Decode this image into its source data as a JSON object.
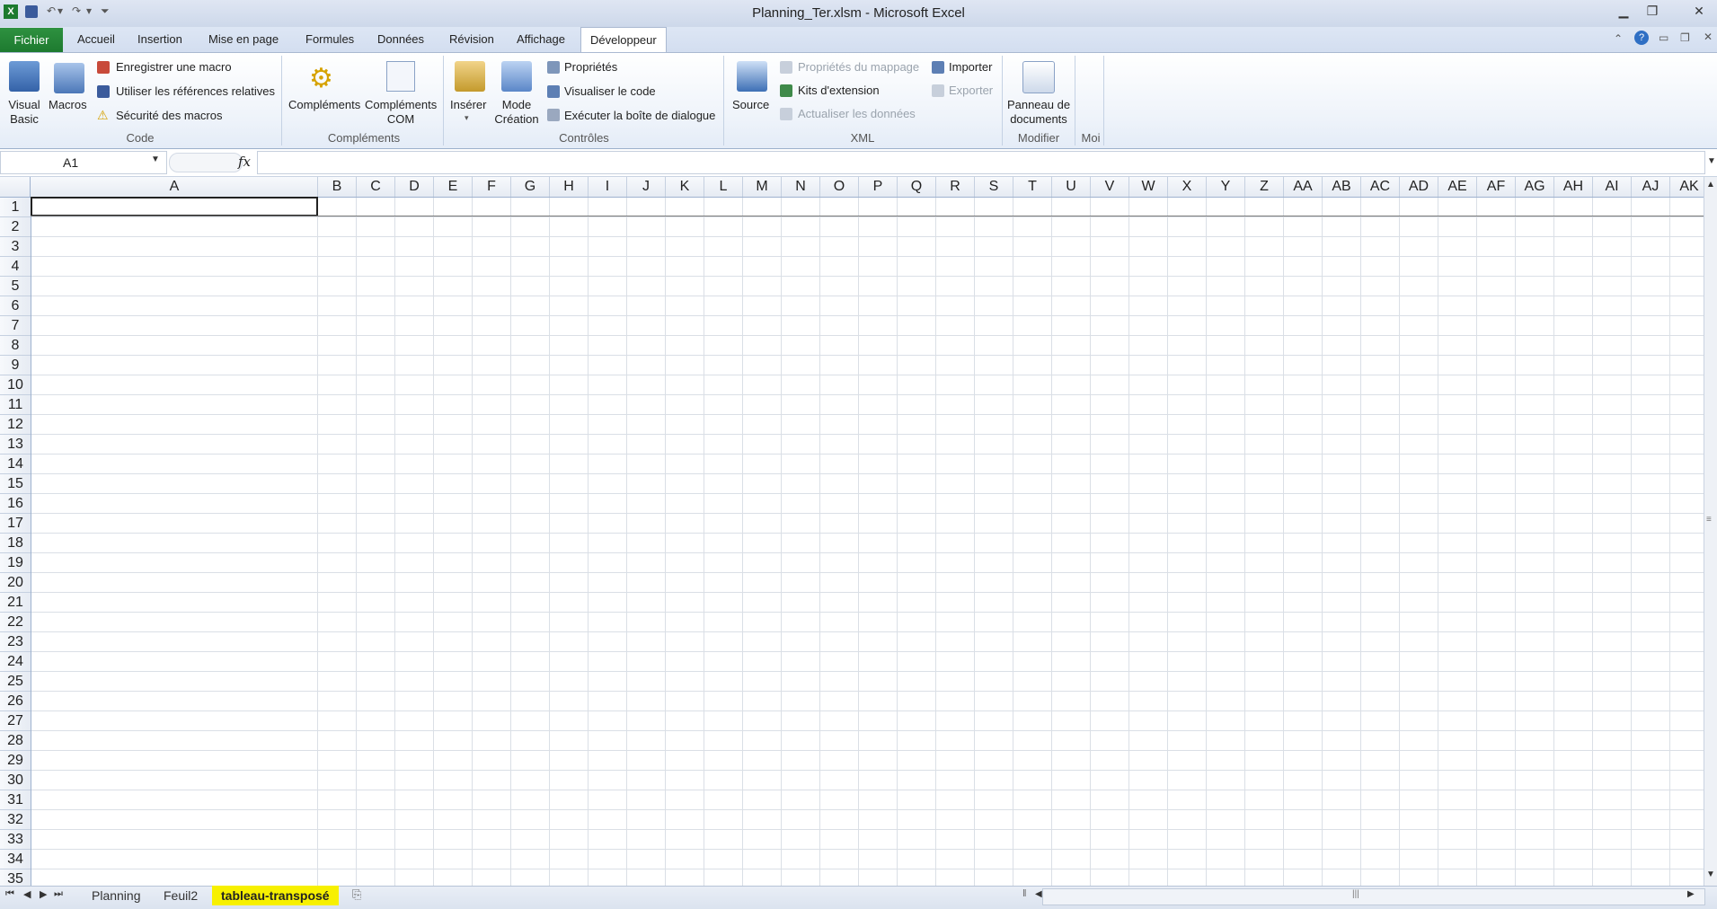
{
  "window": {
    "title": "Planning_Ter.xlsm  -  Microsoft Excel",
    "qat": [
      "save-icon",
      "undo-icon",
      "redo-icon",
      "customize-icon"
    ],
    "controls": [
      "minimize",
      "maximize",
      "close"
    ]
  },
  "tabs": {
    "fichier": "Fichier",
    "items": [
      "Accueil",
      "Insertion",
      "Mise en page",
      "Formules",
      "Données",
      "Révision",
      "Affichage",
      "Développeur"
    ],
    "active": "Développeur"
  },
  "ribbon": {
    "code": {
      "label": "Code",
      "visual_basic": "Visual\nBasic",
      "visual_basic_l1": "Visual",
      "visual_basic_l2": "Basic",
      "macros": "Macros",
      "record_macro": "Enregistrer une macro",
      "relative_refs": "Utiliser les références relatives",
      "macro_security": "Sécurité des macros"
    },
    "addins": {
      "label": "Compléments",
      "complements": "Compléments",
      "com_l1": "Compléments",
      "com_l2": "COM"
    },
    "controls": {
      "label": "Contrôles",
      "insert": "Insérer",
      "mode_l1": "Mode",
      "mode_l2": "Création",
      "properties": "Propriétés",
      "view_code": "Visualiser le code",
      "run_dialog": "Exécuter la boîte de dialogue"
    },
    "xml": {
      "label": "XML",
      "source": "Source",
      "map_props": "Propriétés du mappage",
      "ext_packs": "Kits d'extension",
      "refresh": "Actualiser les données",
      "import": "Importer",
      "export": "Exporter"
    },
    "modify": {
      "label": "Modifier",
      "doc_panel_l1": "Panneau de",
      "doc_panel_l2": "documents"
    },
    "moi": {
      "label": "Moi"
    }
  },
  "formula_bar": {
    "name_box": "A1",
    "fx": "fx",
    "formula": ""
  },
  "grid": {
    "columns": [
      "A",
      "B",
      "C",
      "D",
      "E",
      "F",
      "G",
      "H",
      "I",
      "J",
      "K",
      "L",
      "M",
      "N",
      "O",
      "P",
      "Q",
      "R",
      "S",
      "T",
      "U",
      "V",
      "W",
      "X",
      "Y",
      "Z",
      "AA",
      "AB",
      "AC",
      "AD",
      "AE",
      "AF",
      "AG",
      "AH",
      "AI",
      "AJ",
      "AK"
    ],
    "rows": [
      "1",
      "2",
      "3",
      "4",
      "5",
      "6",
      "7",
      "8",
      "9",
      "10",
      "11",
      "12",
      "13",
      "14",
      "15",
      "16",
      "17",
      "18",
      "19",
      "20",
      "21",
      "22",
      "23",
      "24",
      "25",
      "26",
      "27",
      "28",
      "29",
      "30",
      "31",
      "32",
      "33",
      "34",
      "35"
    ]
  },
  "sheets": {
    "tabs": [
      "Planning",
      "Feuil2",
      "tableau-transposé"
    ],
    "active": "tableau-transposé",
    "highlight_color": "#f7f000"
  },
  "colors": {
    "file_tab": "#2e9140",
    "ribbon_bg": "#eef3fa",
    "grid_line": "#dadfe6"
  }
}
